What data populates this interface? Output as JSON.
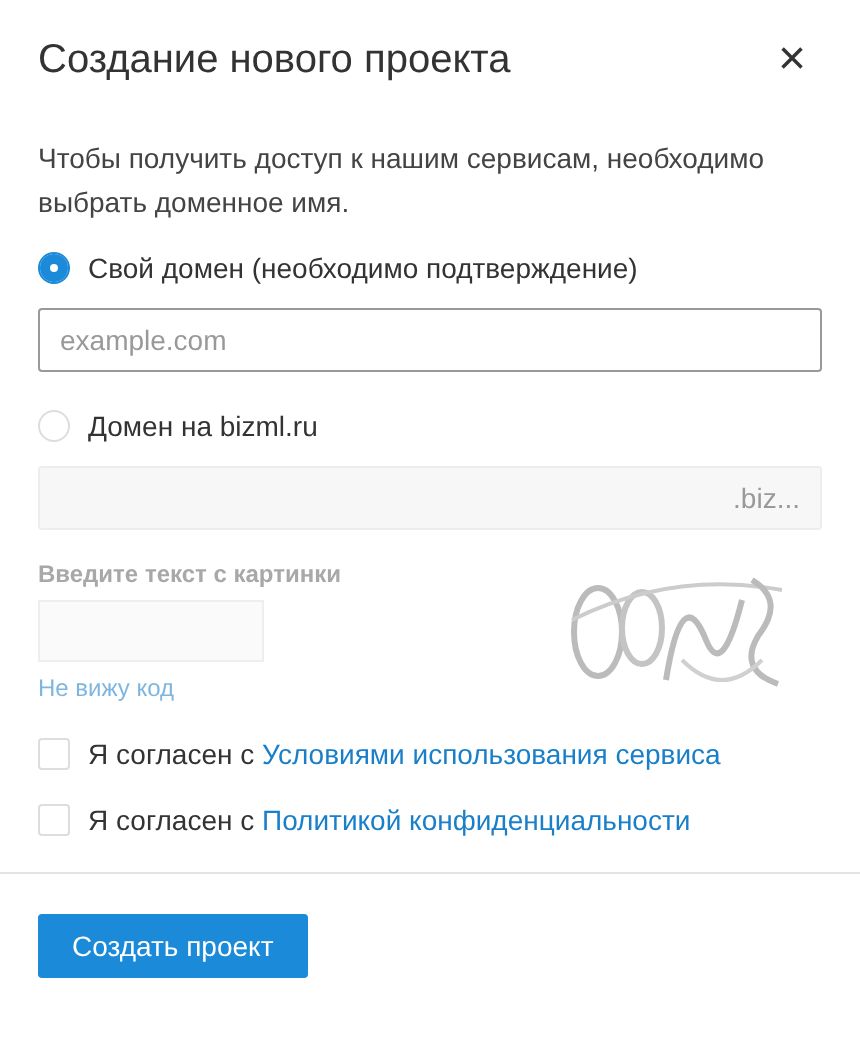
{
  "dialog": {
    "title": "Создание нового проекта",
    "close": "×"
  },
  "intro": "Чтобы получить доступ к нашим сервисам, необходимо выбрать доменное имя.",
  "options": [
    {
      "label": "Свой домен (необходимо подтверждение)",
      "selected": true,
      "field": {
        "placeholder": "example.com",
        "disabled": false
      }
    },
    {
      "label": "Домен на bizml.ru",
      "selected": false,
      "field": {
        "suffix": ".biz...",
        "disabled": true
      }
    }
  ],
  "captcha": {
    "label": "Введите текст с картинки",
    "link": "Не вижу код",
    "disabled": true
  },
  "agreements": [
    {
      "prefix": "Я согласен с",
      "link": "Условиями использования сервиса",
      "checked": false
    },
    {
      "prefix": "Я согласен с",
      "link": "Политикой конфиденциальности",
      "checked": false
    }
  ],
  "submit": "Создать проект"
}
